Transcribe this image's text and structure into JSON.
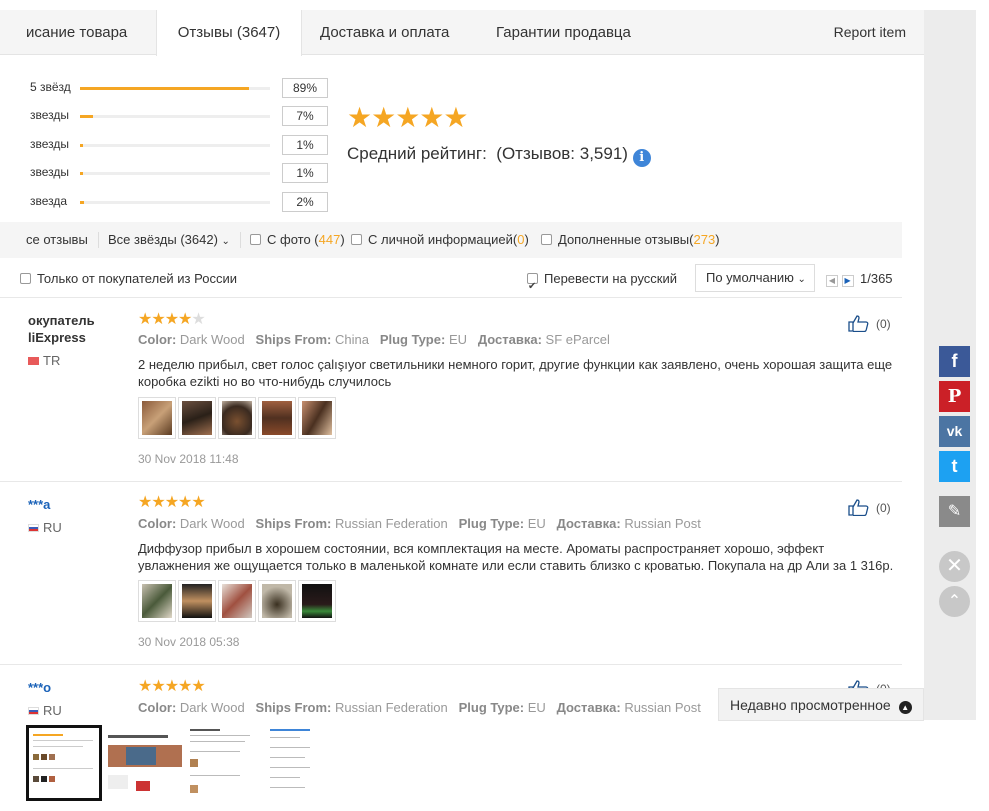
{
  "tabs": {
    "description": "исание товара",
    "reviews": "Отзывы (3647)",
    "shipping": "Доставка и оплата",
    "guarantees": "Гарантии продавца",
    "report": "Report item"
  },
  "ratings": {
    "rows": [
      {
        "label": "5 звёзд",
        "pct": "89%",
        "fill": 0.89
      },
      {
        "label": "звезды",
        "pct": "7%",
        "fill": 0.07
      },
      {
        "label": "звезды",
        "pct": "1%",
        "fill": 0.01
      },
      {
        "label": "звезды",
        "pct": "1%",
        "fill": 0.01
      },
      {
        "label": "звезда",
        "pct": "2%",
        "fill": 0.02
      }
    ],
    "stars": "★★★★★",
    "average_label": "Средний рейтинг:",
    "count_label": "(Отзывов: 3,591)",
    "info_glyph": "i"
  },
  "filter": {
    "all_reviews": "се отзывы",
    "all_stars": "Все звёзды (3642)",
    "with_photo_label": "С фото (",
    "with_photo_count": "447",
    "with_photo_close": ")",
    "personal_label": "С личной информацией(",
    "personal_count": "0",
    "personal_close": ")",
    "additional_label": "Дополненные отзывы(",
    "additional_count": "273",
    "additional_close": ")"
  },
  "subbar": {
    "russia_only": "Только от покупателей из России",
    "translate": "Перевести на русский",
    "sort": "По умолчанию",
    "page": "1/365"
  },
  "reviews": [
    {
      "name_line1": "окупатель",
      "name_line2": "liExpress",
      "country": "TR",
      "stars_on": "★★★★",
      "stars_off": "★",
      "color_k": "Color:",
      "color_v": "Dark Wood",
      "ships_k": "Ships From:",
      "ships_v": "China",
      "plug_k": "Plug Type:",
      "plug_v": "EU",
      "delivery_k": "Доставка:",
      "delivery_v": "SF eParcel",
      "text": "2 неделю прибыл, свет голос çalışıyor светильники немного горит, другие функции как заявлено, очень хорошая защита еще коробка ezikti но во что-нибудь случилось",
      "date": "30 Nov 2018 11:48",
      "likes": "(0)"
    },
    {
      "name_line1": "***a",
      "country": "RU",
      "stars_on": "★★★★★",
      "color_k": "Color:",
      "color_v": "Dark Wood",
      "ships_k": "Ships From:",
      "ships_v": "Russian Federation",
      "plug_k": "Plug Type:",
      "plug_v": "EU",
      "delivery_k": "Доставка:",
      "delivery_v": "Russian Post",
      "text": "Диффузор прибыл в хорошем состоянии, вся комплектация на месте. Ароматы распространяет хорошо, эффект увлажнения же ощущается только в маленькой комнате или если ставить близко с кроватью. Покупала на др Али за 1 316р.",
      "date": "30 Nov 2018 05:38",
      "likes": "(0)"
    },
    {
      "name_line1": "***o",
      "country": "RU",
      "stars_on": "★★★★★",
      "color_k": "Color:",
      "color_v": "Dark Wood",
      "ships_k": "Ships From:",
      "ships_v": "Russian Federation",
      "plug_k": "Plug Type:",
      "plug_v": "EU",
      "delivery_k": "Доставка:",
      "delivery_v": "Russian Post",
      "likes": "(0)"
    }
  ],
  "social": {
    "facebook": "f",
    "pinterest": "P",
    "vk": "vk",
    "twitter": "t"
  },
  "recent": {
    "label": "Недавно просмотренное"
  },
  "colors": {
    "star": "#f5a623",
    "facebook": "#3b5998",
    "pinterest": "#cb2027",
    "vk": "#4c75a3",
    "twitter": "#1da1f2"
  }
}
